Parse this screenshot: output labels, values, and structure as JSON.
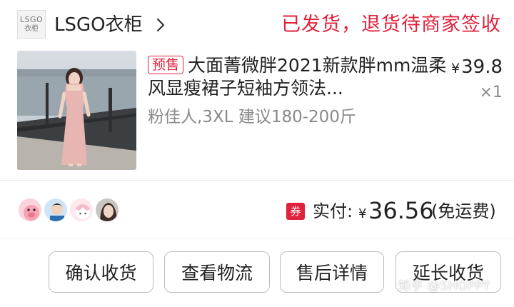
{
  "store": {
    "logo_line1": "LSGO",
    "logo_line2": "衣柜",
    "name": "LSGO衣柜"
  },
  "order_status": "已发货，退货待商家签收",
  "product": {
    "badge": "预售",
    "title": "大面菁微胖2021新款胖mm温柔风显瘦裙子短袖方领法...",
    "price_currency": "¥",
    "price": "39.8",
    "quantity": "×1",
    "sku": "粉佳人,3XL 建议180-200斤"
  },
  "payment": {
    "coupon_icon": "券",
    "label": "实付:",
    "currency": "¥",
    "amount": "36.56",
    "note": "(免运费)"
  },
  "actions": {
    "confirm_receipt": "确认收货",
    "view_logistics": "查看物流",
    "after_sales": "售后详情",
    "extend_receipt": "延长收货"
  },
  "watermark": "知乎 @SHOPPY",
  "colors": {
    "accent_red": "#e0223c",
    "muted_text": "#8a8a8a"
  },
  "icons": [
    "chevron-right-icon",
    "coupon-icon",
    "avatar-pig",
    "avatar-child",
    "avatar-cartoon",
    "avatar-woman"
  ]
}
